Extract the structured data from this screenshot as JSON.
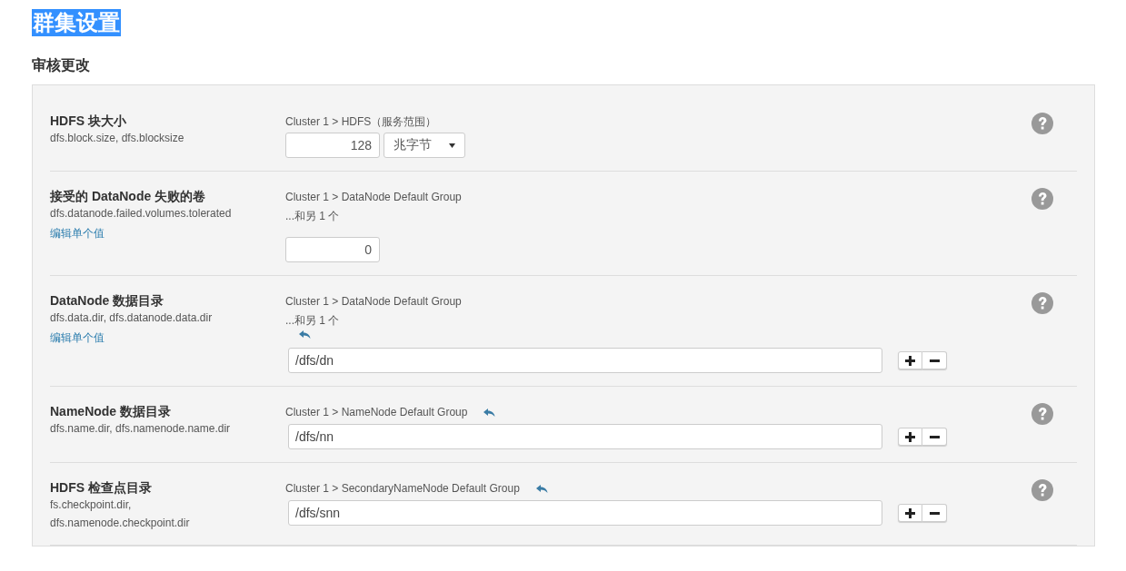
{
  "page": {
    "title": "群集设置",
    "title_highlighted": true,
    "subtitle": "审核更改"
  },
  "settings": [
    {
      "kind": "number_unit",
      "name": "HDFS 块大小",
      "keys": "dfs.block.size, dfs.blocksize",
      "scope": "Cluster 1 > HDFS（服务范围）",
      "value": "128",
      "unit": "兆字节",
      "revert": false
    },
    {
      "kind": "number",
      "name": "接受的 DataNode 失败的卷",
      "keys": "dfs.datanode.failed.volumes.tolerated",
      "edit_link": "编辑单个值",
      "scope": "Cluster 1 > DataNode Default Group",
      "more": "...和另 1 个",
      "value": "0",
      "revert": false
    },
    {
      "kind": "list",
      "name": "DataNode 数据目录",
      "keys": "dfs.data.dir, dfs.datanode.data.dir",
      "edit_link": "编辑单个值",
      "scope": "Cluster 1 > DataNode Default Group",
      "more": "...和另 1 个",
      "value": "/dfs/dn",
      "revert": true
    },
    {
      "kind": "list",
      "name": "NameNode 数据目录",
      "keys": "dfs.name.dir, dfs.namenode.name.dir",
      "scope": "Cluster 1 > NameNode Default Group",
      "value": "/dfs/nn",
      "revert": true
    },
    {
      "kind": "list",
      "name": "HDFS 检查点目录",
      "keys": "fs.checkpoint.dir, dfs.namenode.checkpoint.dir",
      "scope": "Cluster 1 > SecondaryNameNode Default Group",
      "value": "/dfs/snn",
      "revert": true
    }
  ]
}
